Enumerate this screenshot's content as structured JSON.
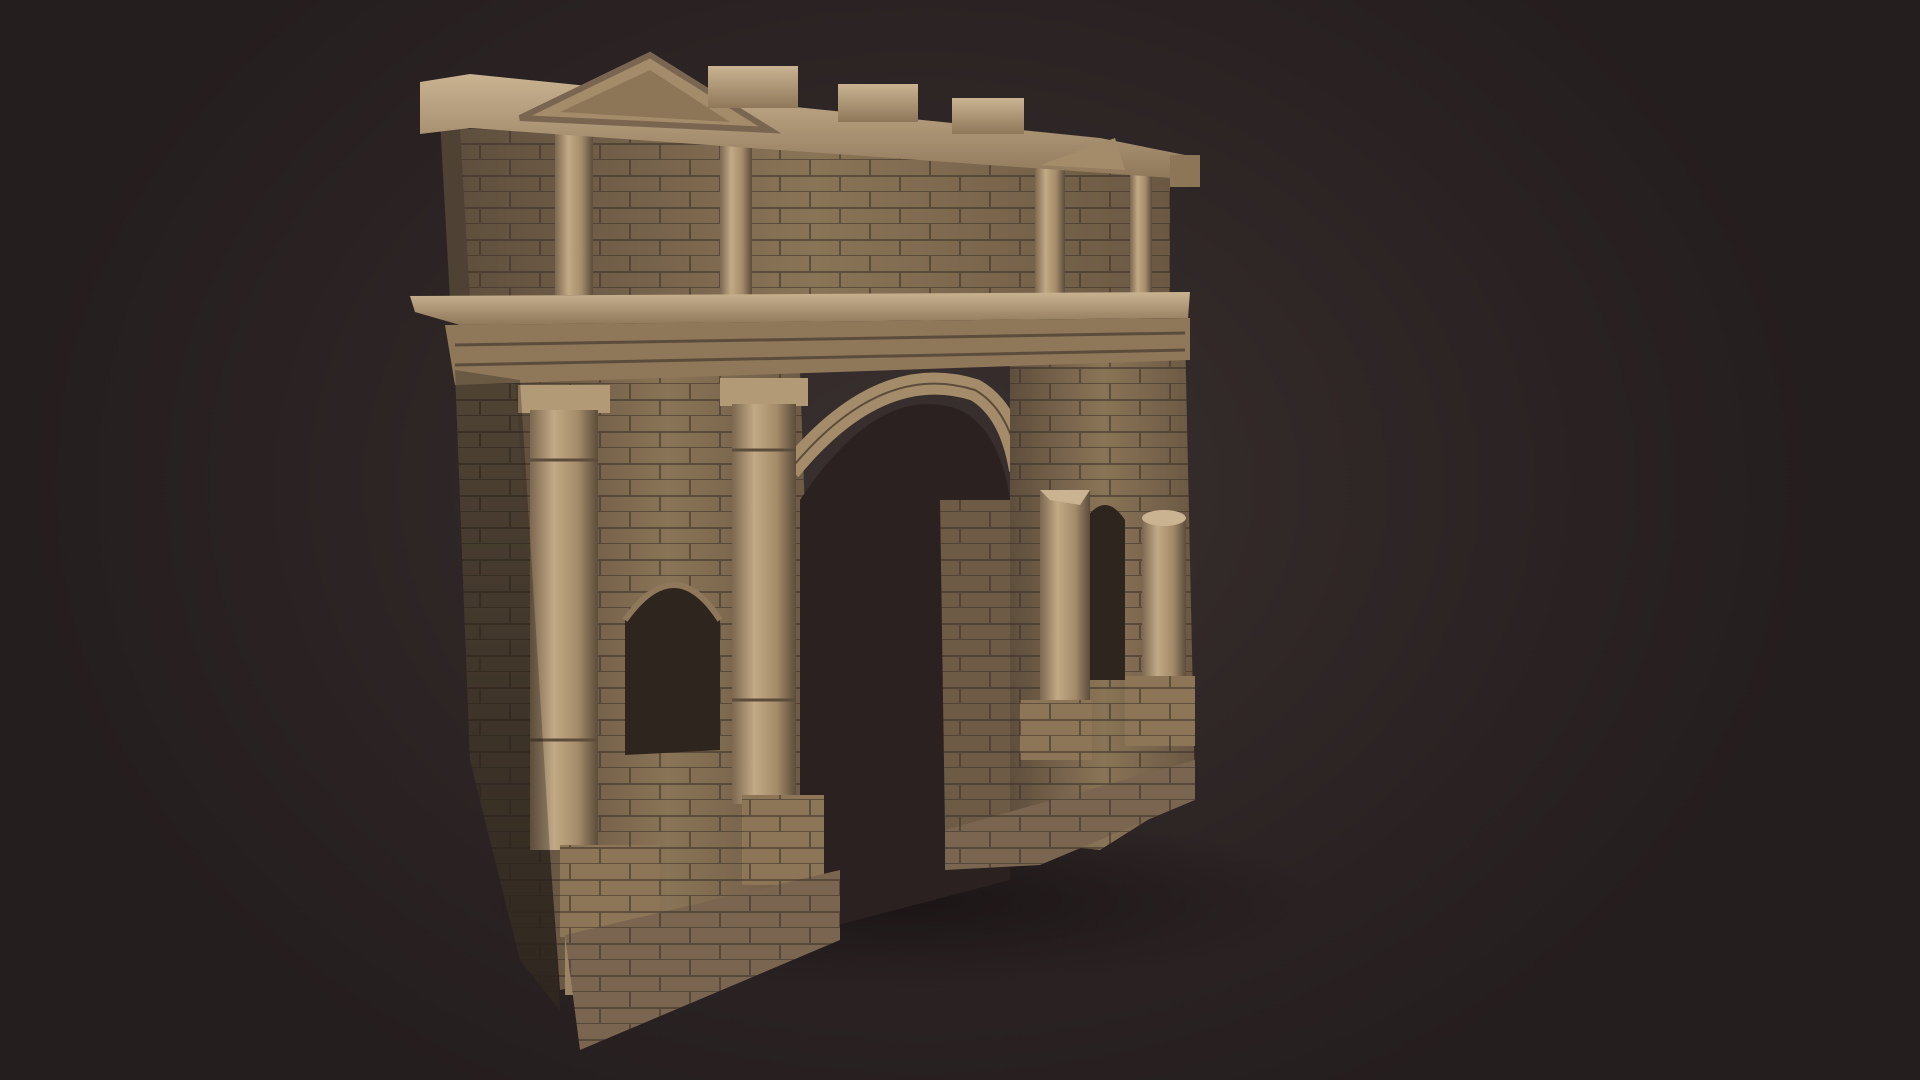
{
  "scene": {
    "model_icon": "stone-arch-ruin-icon",
    "background_color": "#2c2322",
    "stone_light": "#b9a07c",
    "stone_mid": "#8c7657",
    "stone_dark": "#4a3d30",
    "shadow": "#150f0f"
  }
}
